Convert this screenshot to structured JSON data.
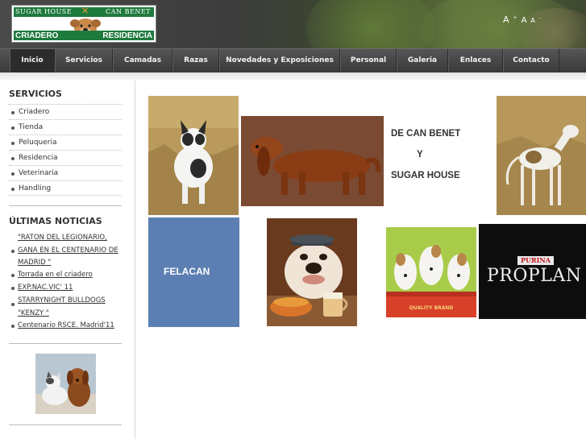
{
  "header": {
    "logo": {
      "line1_left": "SUGAR HOUSE",
      "line1_right": "CAN BENET",
      "line2_left": "CRIADERO",
      "line2_right": "RESIDENCIA"
    },
    "font_sizes": [
      "A",
      "A",
      "A"
    ]
  },
  "nav": {
    "items": [
      {
        "label": "Inicio"
      },
      {
        "label": "Servicios"
      },
      {
        "label": "Camadas"
      },
      {
        "label": "Razas"
      },
      {
        "label": "Novedades y Exposiciones"
      },
      {
        "label": "Personal"
      },
      {
        "label": "Galeria"
      },
      {
        "label": "Enlaces"
      },
      {
        "label": "Contacto"
      }
    ]
  },
  "sidebar": {
    "services_title": "SERVICIOS",
    "services": [
      "Criadero",
      "Tienda",
      "Peluqueria",
      "Residencia",
      "Veterinaria",
      "Handling"
    ],
    "news_title": "ÚLTIMAS NOTICIAS",
    "news": [
      "\"RATON DEL LEGIONARIO, GANA EN EL CENTENARIO DE MADRID \"",
      "Torrada en el criadero",
      "EXP.NAC.VIC' 11",
      "STARRYNIGHT BULLDOGS \"KENZY \"",
      "Centenario RSCE. Madrid'11"
    ]
  },
  "content": {
    "kennel_line1": "DE CAN BENET",
    "kennel_line2": "Y",
    "kennel_line3": "SUGAR HOUSE",
    "felacan_label": "FELACAN",
    "purina_label": "PURINA",
    "proplan_label": "PROPLAN",
    "quality_label": "QUALITY BRAND"
  },
  "colors": {
    "nav_bg": "#444444",
    "felacan_blue": "#5b7fb2",
    "logo_green": "#1f7a3d"
  }
}
